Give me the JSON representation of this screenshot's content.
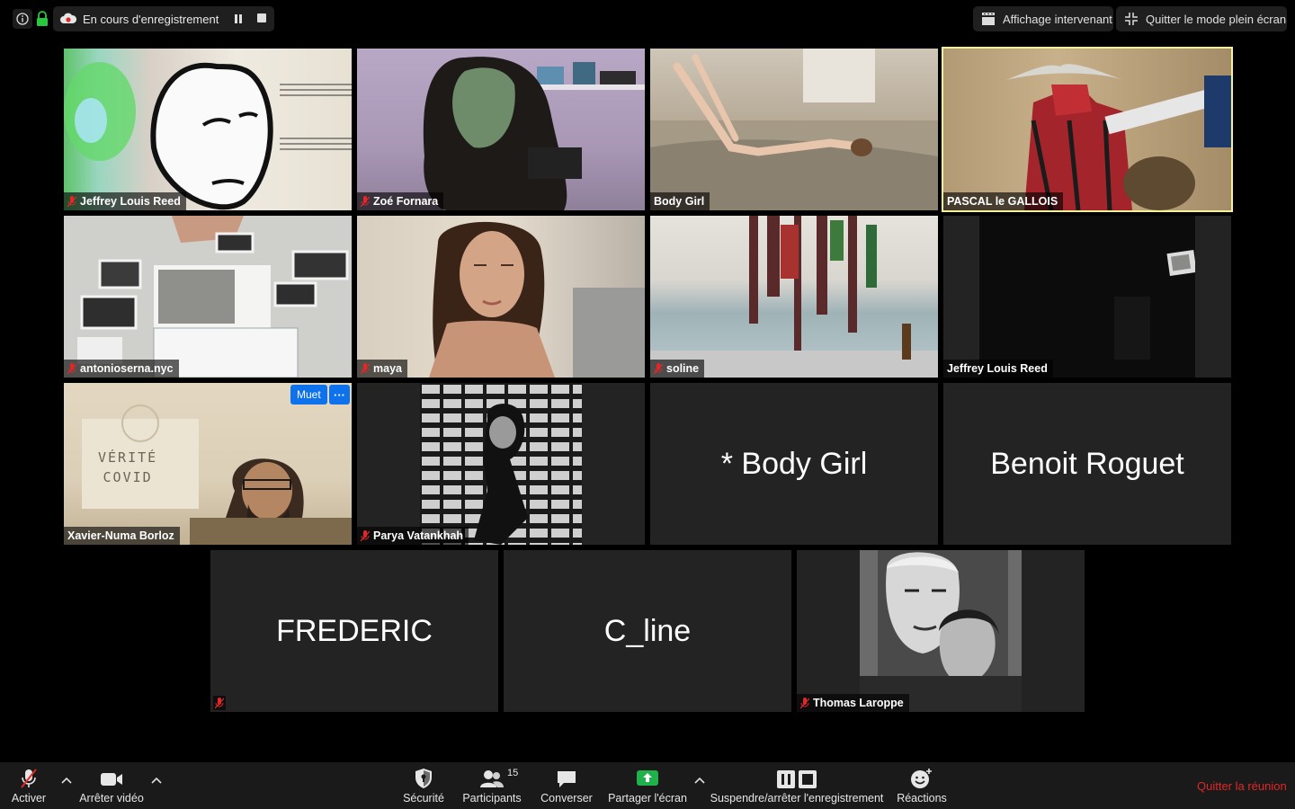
{
  "top_bar": {
    "recording_label": "En cours d'enregistrement",
    "speaker_view_label": "Affichage intervenant",
    "exit_fullscreen_label": "Quitter le mode plein écran"
  },
  "tiles": [
    {
      "name": "Jeffrey Louis Reed",
      "muted": true
    },
    {
      "name": "Zoé Fornara",
      "muted": true
    },
    {
      "name": "Body Girl",
      "muted": false
    },
    {
      "name": "PASCAL le GALLOIS",
      "muted": false,
      "active_speaker": true
    },
    {
      "name": "antonioserna.nyc",
      "muted": true
    },
    {
      "name": "maya",
      "muted": true
    },
    {
      "name": "soline",
      "muted": true
    },
    {
      "name": "Jeffrey Louis Reed",
      "muted": false
    },
    {
      "name": "Xavier-Numa Borloz",
      "muted": false,
      "hover_mute_label": "Muet",
      "hover_more_label": "···",
      "sign_lines": [
        "VÉRITÉ",
        "COVID"
      ]
    },
    {
      "name": "Parya Vatankhah",
      "muted": true
    },
    {
      "name": "* Body Girl",
      "camera_off": true
    },
    {
      "name": "Benoit Roguet",
      "camera_off": true
    },
    {
      "name": "FREDERIC",
      "camera_off": true,
      "muted": true
    },
    {
      "name": "C_line",
      "camera_off": true
    },
    {
      "name": "Thomas Laroppe",
      "muted": true
    }
  ],
  "toolbar": {
    "unmute_label": "Activer",
    "stop_video_label": "Arrêter vidéo",
    "security_label": "Sécurité",
    "participants_label": "Participants",
    "participants_count": "15",
    "chat_label": "Converser",
    "share_label": "Partager l'écran",
    "record_label": "Suspendre/arrêter l'enregistrement",
    "reactions_label": "Réactions",
    "leave_label": "Quitter la réunion"
  },
  "colors": {
    "active_speaker_border": "#f6f29a",
    "muted_mic": "#e02828",
    "share_green": "#21b14b",
    "button_blue": "#0e72ed",
    "leave_red": "#e02828"
  }
}
